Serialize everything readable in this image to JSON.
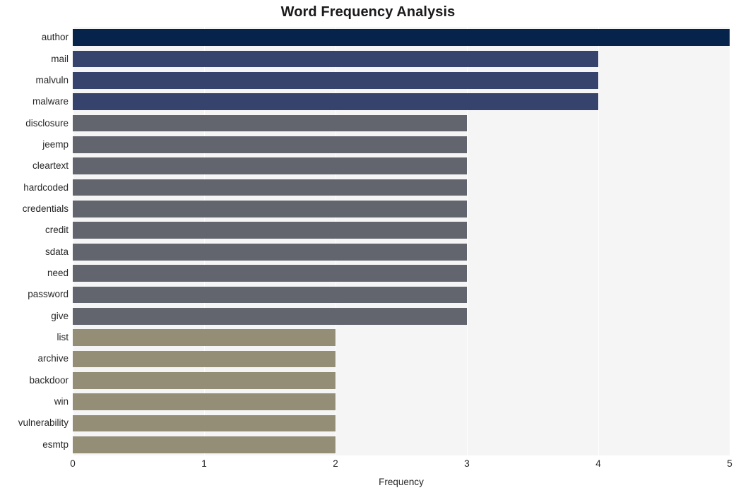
{
  "chart_data": {
    "type": "bar",
    "orientation": "horizontal",
    "title": "Word Frequency Analysis",
    "xlabel": "Frequency",
    "ylabel": "",
    "xlim": [
      0,
      5
    ],
    "x_ticks": [
      "0",
      "1",
      "2",
      "3",
      "4",
      "5"
    ],
    "x_tick_values": [
      0,
      1,
      2,
      3,
      4,
      5
    ],
    "grid": "vertical",
    "legend": "none",
    "categories": [
      "author",
      "mail",
      "malvuln",
      "malware",
      "disclosure",
      "jeemp",
      "cleartext",
      "hardcoded",
      "credentials",
      "credit",
      "sdata",
      "need",
      "password",
      "give",
      "list",
      "archive",
      "backdoor",
      "win",
      "vulnerability",
      "esmtp"
    ],
    "values": [
      5,
      4,
      4,
      4,
      3,
      3,
      3,
      3,
      3,
      3,
      3,
      3,
      3,
      3,
      2,
      2,
      2,
      2,
      2,
      2
    ],
    "bar_colors": [
      "#06234c",
      "#35436d",
      "#35436d",
      "#35436d",
      "#62656e",
      "#62656e",
      "#62656e",
      "#62656e",
      "#62656e",
      "#62656e",
      "#62656e",
      "#62656e",
      "#62656e",
      "#62656e",
      "#958e77",
      "#958e77",
      "#958e77",
      "#958e77",
      "#958e77",
      "#958e77"
    ]
  },
  "style": {
    "figure_background": "#ffffff",
    "plot_background": "#f5f5f6",
    "gridline_color": "#fefefe",
    "text_color": "#262626"
  }
}
